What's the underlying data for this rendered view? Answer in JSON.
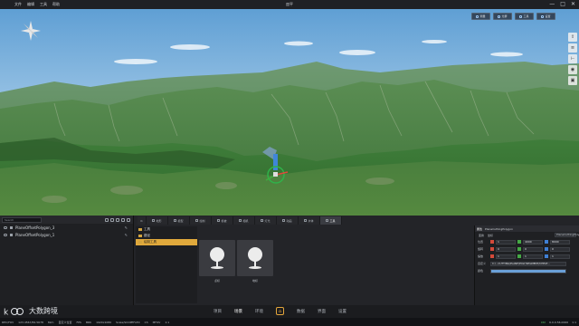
{
  "titlebar": {
    "menu": [
      "文件",
      "编辑",
      "工具",
      "帮助"
    ],
    "title": "皿平",
    "controls": [
      "—",
      "□",
      "✕"
    ]
  },
  "viewport": {
    "toolbar": [
      "测量",
      "分屏",
      "工具",
      "设置"
    ],
    "side_tools": [
      "share-icon",
      "layers-icon",
      "ruler-icon",
      "visibility-icon",
      "camera-icon"
    ],
    "compass": "compass-icon"
  },
  "scene_tree": {
    "search_placeholder": "Search",
    "items": [
      {
        "label": "PlaneOffsetPolygon_3"
      },
      {
        "label": "PlaneOffsetPolygon_1"
      }
    ]
  },
  "panel_tabs": {
    "tabs": [
      "地形",
      "模型",
      "绘制",
      "植被",
      "相机",
      "灯光",
      "动画",
      "水体",
      "工具"
    ],
    "active": "工具"
  },
  "library": {
    "items": [
      {
        "label": "工具"
      },
      {
        "label": "路径"
      },
      {
        "label": "绘制工具"
      }
    ],
    "selected": "绘制工具"
  },
  "assets": [
    {
      "caption": "点标"
    },
    {
      "caption": "地标"
    }
  ],
  "properties": {
    "tabs": [
      "属性",
      "PlaneCuttingPolygon"
    ],
    "sub_label": "变换",
    "sub_values": [
      "坐标",
      "PlaneCuttingPolygon"
    ],
    "rows": [
      {
        "label": "位置",
        "values": [
          "1",
          "4000",
          "8000"
        ]
      },
      {
        "label": "旋转",
        "values": [
          "0",
          "0",
          "0"
        ]
      },
      {
        "label": "缩放",
        "values": [
          "1",
          "1",
          "1"
        ]
      }
    ],
    "path_label": "自定义",
    "path_value": "C:/...CUTTING/PLANE/POLY/SEGMENT/CHEAT...",
    "color_label": "颜色"
  },
  "nav": {
    "brand": "大数跨境",
    "items_left": [
      "项目",
      "场景",
      "环境"
    ],
    "items_right": [
      "数据",
      "界面",
      "设置"
    ],
    "current": "场景"
  },
  "status": {
    "left": [
      "REC/FOV",
      "123.4567/84.5678",
      "8km",
      "自定义位置",
      "FPS",
      "BRK",
      "1920x1080",
      "Scale/SCOPEFLEX",
      "Ch",
      "MFOV",
      "1:1"
    ],
    "right": [
      "Ctrl",
      "6.0.0.56.0000",
      "1:1"
    ]
  },
  "colors": {
    "accent": "#e3a53b",
    "sky_top": "#5f9fd4",
    "mountain": "#3f7d3a",
    "valley": "#4a7f3e"
  }
}
